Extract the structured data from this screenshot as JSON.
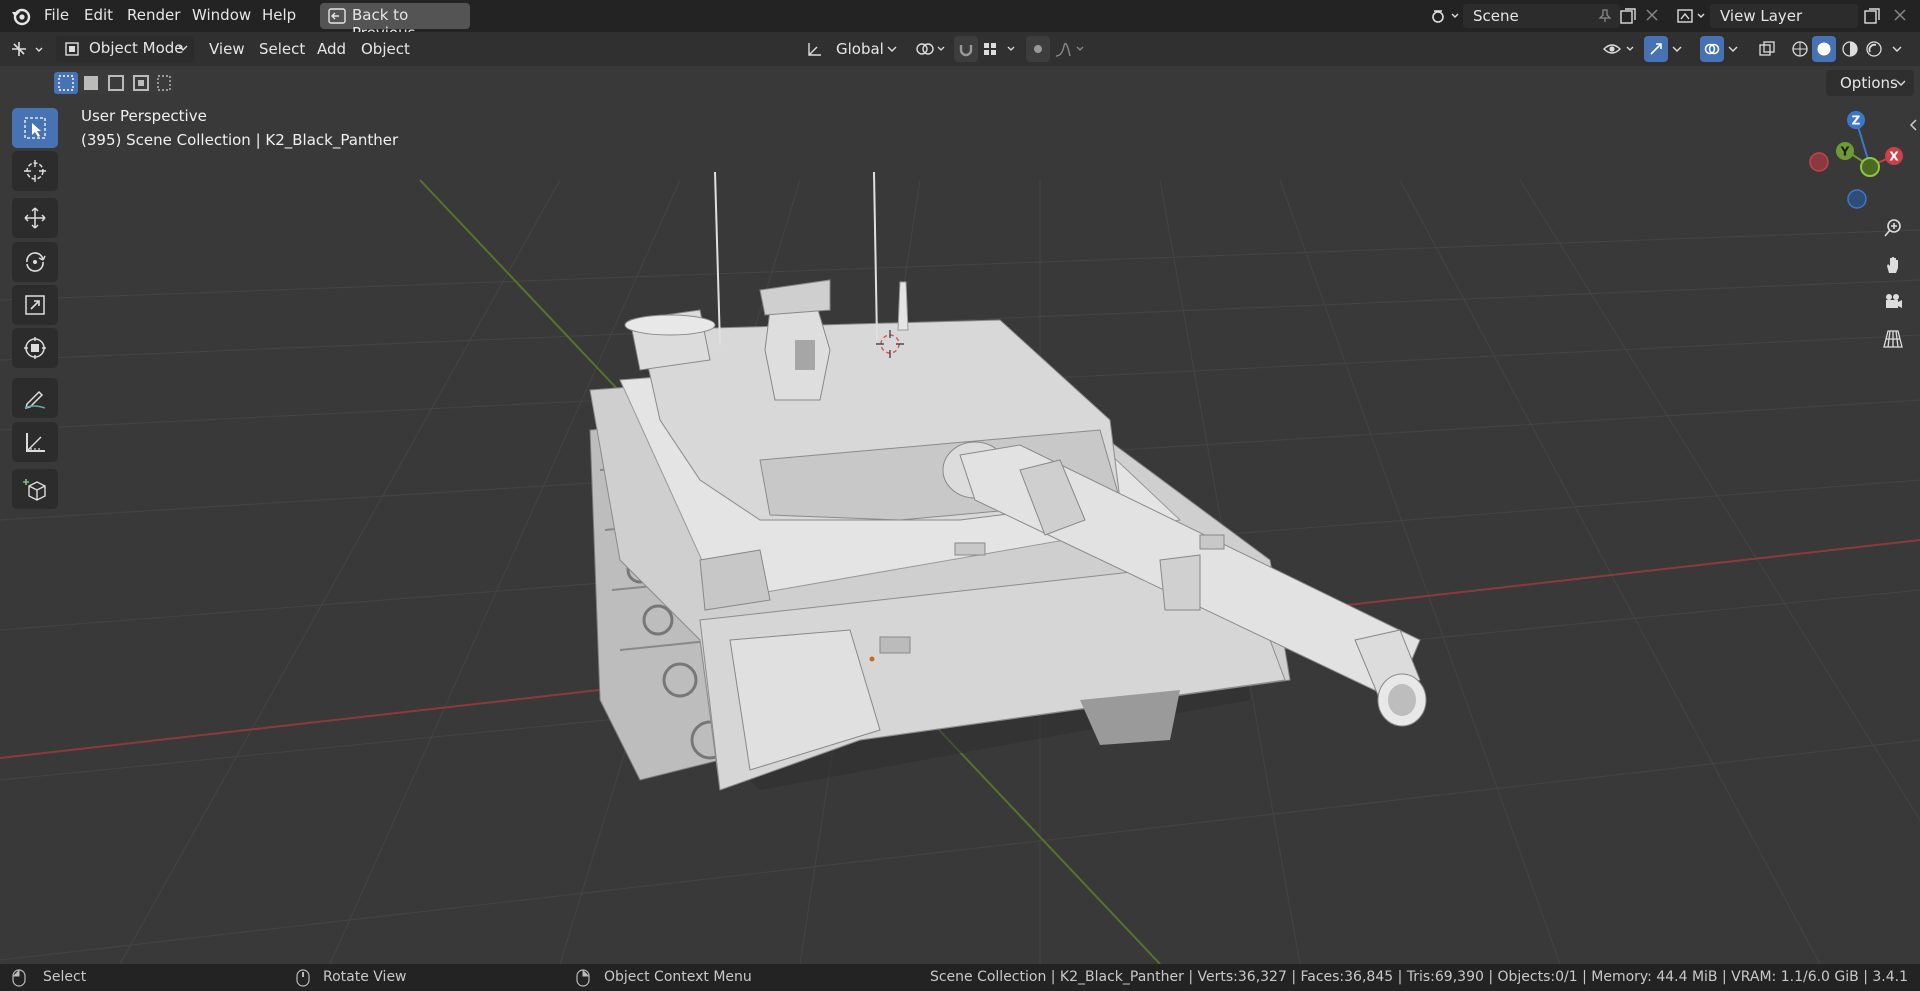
{
  "menu": {
    "file": "File",
    "edit": "Edit",
    "render": "Render",
    "window": "Window",
    "help": "Help",
    "back_to_previous": "Back to Previous"
  },
  "scene": {
    "name": "Scene"
  },
  "view_layer": {
    "name": "View Layer"
  },
  "viewport_header": {
    "mode": "Object Mode",
    "view": "View",
    "select": "Select",
    "add": "Add",
    "object": "Object",
    "transform_orientation": "Global",
    "options": "Options"
  },
  "viewport_overlay": {
    "perspective": "User Perspective",
    "collection_info": "(395) Scene Collection | K2_Black_Panther"
  },
  "gizmo": {
    "z": "Z",
    "y": "Y",
    "x": "X"
  },
  "statusbar": {
    "select": "Select",
    "rotate_view": "Rotate View",
    "context_menu": "Object Context Menu",
    "stats": "Scene Collection | K2_Black_Panther | Verts:36,327 | Faces:36,845 | Tris:69,390 | Objects:0/1 | Memory: 44.4 MiB | VRAM: 1.1/6.0 GiB | 3.4.1"
  },
  "colors": {
    "accent_blue": "#4772b3",
    "x_axis": "#c8414b",
    "y_axis": "#6f9a32",
    "z_axis": "#3a79c9",
    "viewport_bg": "#393939"
  }
}
